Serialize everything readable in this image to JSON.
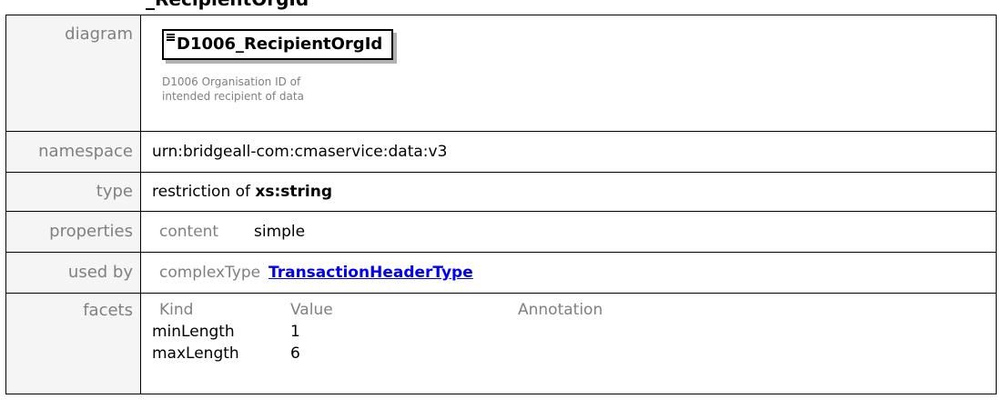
{
  "heading": "_RecipientOrgId",
  "rows": {
    "diagram": {
      "label": "diagram",
      "element_name": "D1006_RecipientOrgId",
      "element_doc_line1": "D1006 Organisation ID of",
      "element_doc_line2": "intended recipient of data"
    },
    "namespace": {
      "label": "namespace",
      "value": "urn:bridgeall-com:cmaservice:data:v3"
    },
    "type": {
      "label": "type",
      "prefix": "restriction of ",
      "base": "xs:string"
    },
    "properties": {
      "label": "properties",
      "key": "content",
      "value": "simple"
    },
    "used_by": {
      "label": "used by",
      "key": "complexType",
      "link": "TransactionHeaderType"
    },
    "facets": {
      "label": "facets",
      "headers": [
        "Kind",
        "Value",
        "Annotation"
      ],
      "rows": [
        {
          "kind": "minLength",
          "value": "1",
          "annotation": ""
        },
        {
          "kind": "maxLength",
          "value": "6",
          "annotation": ""
        }
      ]
    }
  },
  "colors": {
    "label_text": "#808080",
    "label_bg": "#f5f5f5",
    "link": "#0000ee",
    "border": "#000000"
  }
}
